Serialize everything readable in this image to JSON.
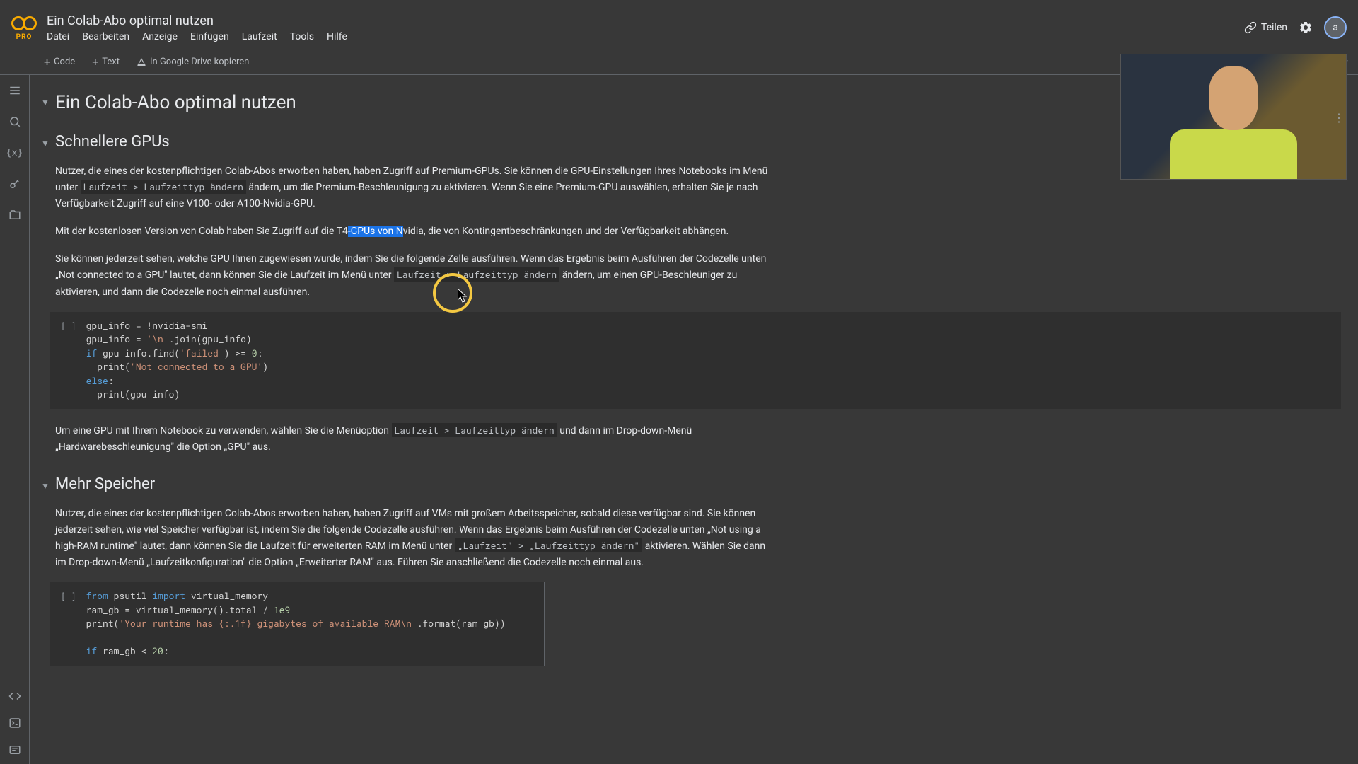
{
  "logo": {
    "pro": "PRO"
  },
  "doc": {
    "title": "Ein Colab-Abo optimal nutzen"
  },
  "menu": {
    "file": "Datei",
    "edit": "Bearbeiten",
    "view": "Anzeige",
    "insert": "Einfügen",
    "runtime": "Laufzeit",
    "tools": "Tools",
    "help": "Hilfe"
  },
  "toolbar": {
    "code": "Code",
    "text": "Text",
    "copy_drive": "In Google Drive kopieren"
  },
  "header": {
    "share": "Teilen",
    "avatar": "a"
  },
  "sections": {
    "main_heading": "Ein Colab-Abo optimal nutzen",
    "faster_gpus": "Schnellere GPUs",
    "more_memory": "Mehr Speicher"
  },
  "text": {
    "p1a": "Nutzer, die eines der kostenpflichtigen Colab-Abos erworben haben, haben Zugriff auf Premium-GPUs. Sie können die GPU-Einstellungen Ihres Notebooks im Menü unter ",
    "p1_code": "Laufzeit > Laufzeittyp ändern",
    "p1b": " ändern, um die Premium-Beschleunigung zu aktivieren. Wenn Sie eine Premium-GPU auswählen, erhalten Sie je nach Verfügbarkeit Zugriff auf eine V100- oder A100-Nvidia-GPU.",
    "p2a": "Mit der kostenlosen Version von Colab haben Sie Zugriff auf die T4",
    "p2_sel": "-GPUs von N",
    "p2b": "vidia, die von Kontingentbeschränkungen und der Verfügbarkeit abhängen.",
    "p3a": "Sie können jederzeit sehen, welche GPU Ihnen zugewiesen wurde, indem Sie die folgende Zelle ausführen. Wenn das Ergebnis beim Ausführen der Codezelle unten „Not connected to a GPU\" lautet, dann können Sie die Laufzeit im Menü unter ",
    "p3_code": "Laufzeit > Laufzeittyp ändern",
    "p3b": " ändern, um einen GPU-Beschleuniger zu aktivieren, und dann die Codezelle noch einmal ausführen.",
    "p4a": "Um eine GPU mit Ihrem Notebook zu verwenden, wählen Sie die Menüoption ",
    "p4_code": "Laufzeit > Laufzeittyp ändern",
    "p4b": " und dann im Drop-down-Menü „Hardwarebeschleunigung\" die Option „GPU\" aus.",
    "p5a": "Nutzer, die eines der kostenpflichtigen Colab-Abos erworben haben, haben Zugriff auf VMs mit großem Arbeitsspeicher, sobald diese verfügbar sind. Sie können jederzeit sehen, wie viel Speicher verfügbar ist, indem Sie die folgende Codezelle ausführen. Wenn das Ergebnis beim Ausführen der Codezelle unten „Not using a high-RAM runtime\" lautet, dann können Sie die Laufzeit für erweiterten RAM im Menü unter ",
    "p5_code": "„Laufzeit\" > „Laufzeittyp ändern\"",
    "p5b": " aktivieren. Wählen Sie dann im Drop-down-Menü „Laufzeitkonfiguration\" die Option „Erweiterter RAM\" aus. Führen Sie anschließend die Codezelle noch einmal aus."
  },
  "code1": {
    "gutter": "[ ]",
    "l1a": "gpu_info = !nvidia-smi",
    "l2a": "gpu_info = ",
    "l2b": "'\\n'",
    "l2c": ".join(gpu_info)",
    "l3a": "if",
    "l3b": " gpu_info.find(",
    "l3c": "'failed'",
    "l3d": ") >= ",
    "l3e": "0",
    "l3f": ":",
    "l4a": "  print(",
    "l4b": "'Not connected to a GPU'",
    "l4c": ")",
    "l5a": "else",
    "l5b": ":",
    "l6a": "  print(gpu_info)"
  },
  "code2": {
    "gutter": "[ ]",
    "l1a": "from",
    "l1b": " psutil ",
    "l1c": "import",
    "l1d": " virtual_memory",
    "l2a": "ram_gb = virtual_memory().total / ",
    "l2b": "1e9",
    "l3a": "print(",
    "l3b": "'Your runtime has {:.1f} gigabytes of available RAM\\n'",
    "l3c": ".format(ram_gb))",
    "l4a": "if",
    "l4b": " ram_gb < ",
    "l4c": "20",
    "l4d": ":"
  }
}
